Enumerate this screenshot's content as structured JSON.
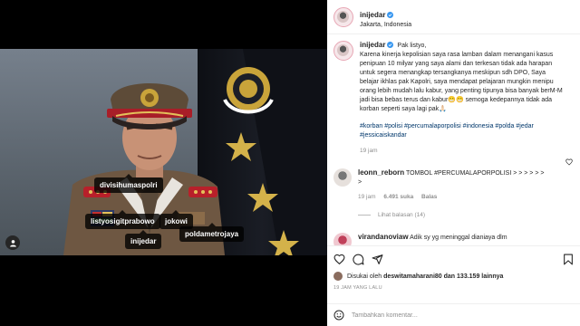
{
  "post": {
    "username": "inijedar",
    "location": "Jakarta, Indonesia"
  },
  "image_tags": [
    {
      "name": "tag-divisihumaspolri",
      "label": "divisihumaspolri"
    },
    {
      "name": "tag-listyosigitprabowo",
      "label": "listyosigitprabowo"
    },
    {
      "name": "tag-jokowi",
      "label": "jokowi"
    },
    {
      "name": "tag-poldametrojaya",
      "label": "poldametrojaya"
    },
    {
      "name": "tag-inijedar",
      "label": "inijedar"
    }
  ],
  "caption": {
    "username": "inijedar",
    "greeting": "Pak listyo,",
    "body": "Karena kinerja kepolisian saya rasa lamban dalam menangani kasus penipuan 10 milyar yang saya alami dan terkesan tidak ada harapan untuk segera menangkap tersangkanya meskipun sdh DPO, Saya belajar ikhlas pak Kapolri, saya mendapat pelajaran mungkin menipu orang lebih mudah lalu kabur, yang penting tipunya bisa banyak berM-M jadi bisa bebas terus dan kabur😁😁 semoga kedepannya tidak ada korban seperti saya lagi pak🙏🏻",
    "hashtags": "#korban #polisi #percumalaporpolisi #indonesia #polda #jedar #jessicaiskandar",
    "time": "19 jam"
  },
  "comments": [
    {
      "username": "leonn_reborn",
      "text": "TOMBOL #PERCUMALAPORPOLISI > > > > > > >",
      "time": "19 jam",
      "likes": "6.491 suka",
      "reply": "Balas",
      "view_replies": "Lihat balasan (14)"
    },
    {
      "username": "virandanoviaw",
      "text": "Adik sy yg meninggal dianiaya dlm"
    }
  ],
  "likes": {
    "prefix": "Disukai oleh",
    "user": "deswitamaharani80",
    "suffix": "dan 133.159 lainnya"
  },
  "timestamp": "19 JAM YANG LALU",
  "comment_input": {
    "placeholder": "Tambahkan komentar..."
  },
  "colors": {
    "verified": "#3897f0",
    "hashtag": "#00376b",
    "muted": "#8e8e8e"
  }
}
